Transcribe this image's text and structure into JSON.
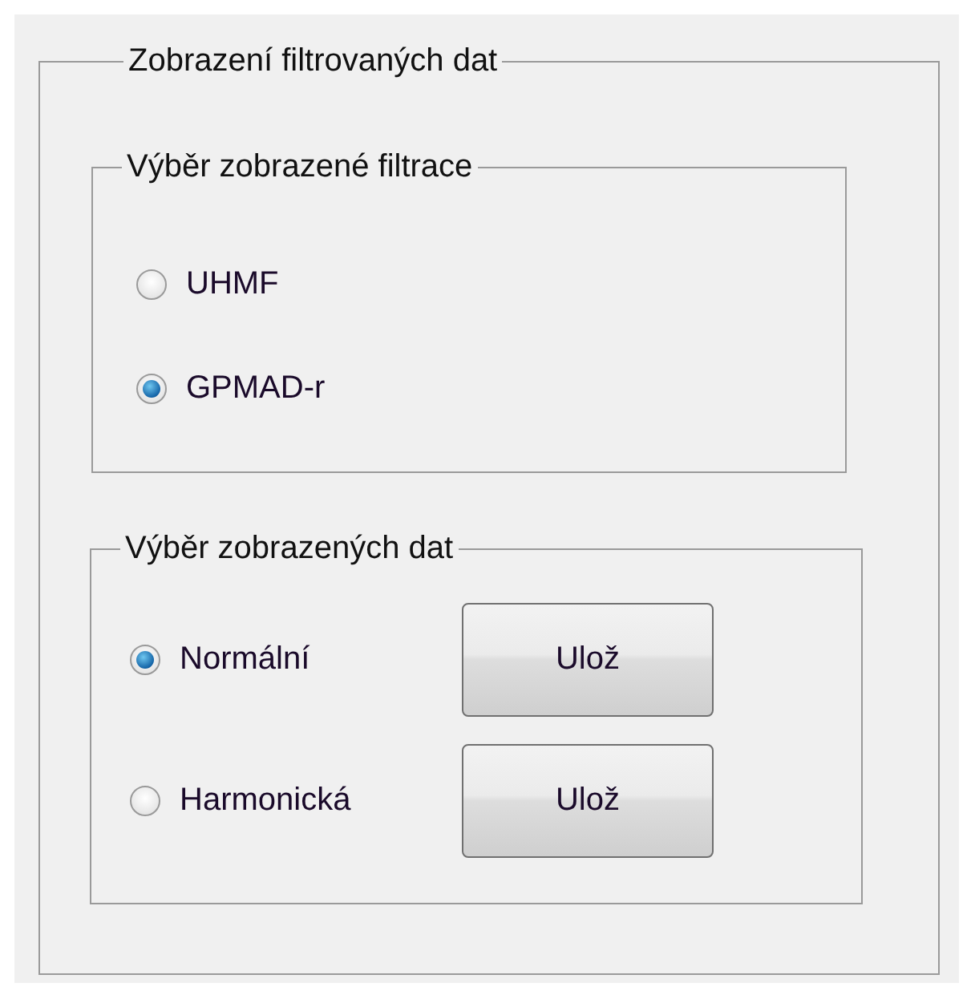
{
  "panel": {
    "title": "Zobrazení filtrovaných dat",
    "groups": [
      {
        "title": "Výběr zobrazené filtrace",
        "options": [
          {
            "label": "UHMF",
            "selected": false
          },
          {
            "label": "GPMAD-r",
            "selected": true
          }
        ]
      },
      {
        "title": "Výběr zobrazených dat",
        "options": [
          {
            "label": "Normální",
            "selected": true,
            "button": "Ulož"
          },
          {
            "label": "Harmonická",
            "selected": false,
            "button": "Ulož"
          }
        ]
      }
    ]
  }
}
